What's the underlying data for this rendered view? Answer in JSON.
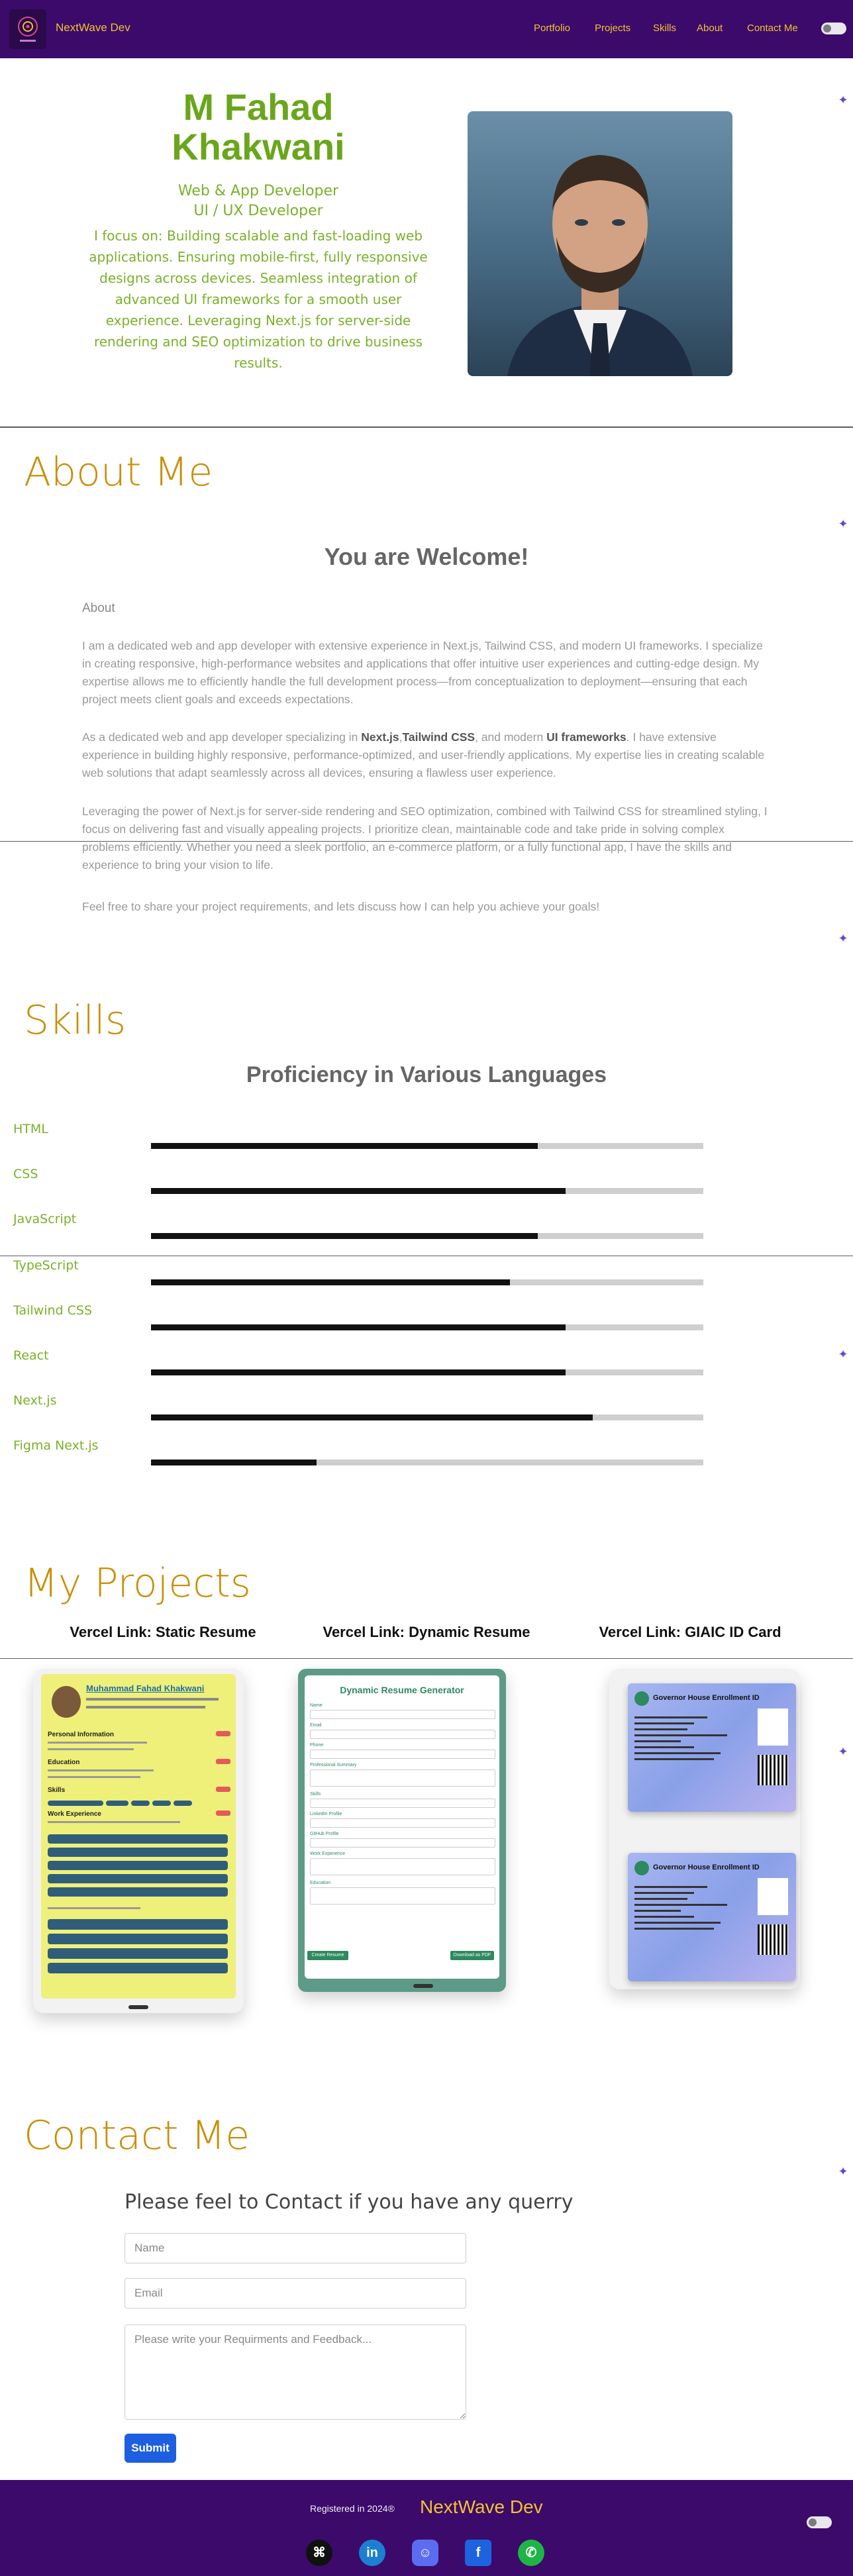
{
  "header": {
    "brand": "NextWave Dev",
    "nav": [
      "Portfolio",
      "Projects",
      "Skills",
      "About",
      "Contact Me"
    ]
  },
  "hero": {
    "name": "M Fahad Khakwani",
    "role1": "Web & App Developer",
    "role2": "UI / UX Developer",
    "description": "I focus on: Building scalable and fast-loading web applications. Ensuring mobile-first, fully responsive designs across devices. Seamless integration of advanced UI frameworks for a smooth user experience. Leveraging Next.js for server-side rendering and SEO optimization to drive business results."
  },
  "about": {
    "title": "About Me",
    "subtitle": "You are Welcome!",
    "label": "About",
    "p1": "I am a dedicated web and app developer with extensive experience in Next.js, Tailwind CSS, and modern UI frameworks. I specialize in creating responsive, high-performance websites and applications that offer intuitive user experiences and cutting-edge design. My expertise allows me to efficiently handle the full development process—from conceptualization to deployment—ensuring that each project meets client goals and exceeds expectations.",
    "p2_a": "As a dedicated web and app developer specializing in ",
    "p2_b": "Next.js",
    "p2_c": ",",
    "p2_d": "Tailwind CSS",
    "p2_e": ", and modern ",
    "p2_f": "UI frameworks",
    "p2_g": ". I have extensive experience in building highly responsive, performance-optimized, and user-friendly applications. My expertise lies in creating scalable web solutions that adapt seamlessly across all devices, ensuring a flawless user experience.",
    "p3": "Leveraging the power of Next.js for server-side rendering and SEO optimization, combined with Tailwind CSS for streamlined styling, I focus on delivering fast and visually appealing projects. I prioritize clean, maintainable code and take pride in solving complex problems efficiently. Whether you need a sleek portfolio, an e-commerce platform, or a fully functional app, I have the skills and experience to bring your vision to life.",
    "p4": "Feel free to share your project requirements, and lets discuss how I can help you achieve your goals!"
  },
  "skills": {
    "title": "Skills",
    "subtitle": "Proficiency in Various Languages",
    "items": [
      {
        "name": "HTML",
        "level": 0.7
      },
      {
        "name": "CSS",
        "level": 0.75
      },
      {
        "name": "JavaScript",
        "level": 0.7
      },
      {
        "name": "TypeScript",
        "level": 0.65
      },
      {
        "name": "Tailwind CSS",
        "level": 0.75
      },
      {
        "name": "React",
        "level": 0.75
      },
      {
        "name": "Next.js",
        "level": 0.8
      },
      {
        "name": "Figma Next.js",
        "level": 0.3
      }
    ]
  },
  "projects": {
    "title": "My Projects",
    "items": [
      {
        "title": "Vercel Link: Static Resume"
      },
      {
        "title": "Vercel Link: Dynamic Resume"
      },
      {
        "title": "Vercel Link: GIAIC ID Card"
      }
    ],
    "static_resume": {
      "name": "Muhammad Fahad Khakwani",
      "sections": [
        "Personal Information",
        "Education",
        "Skills",
        "Work Experience"
      ]
    },
    "dynamic_resume": {
      "heading": "Dynamic Resume Generator",
      "fields": [
        "Name",
        "Email",
        "Phone",
        "Professional Summary",
        "Skills",
        "LinkedIn Profile",
        "GitHub Profile",
        "Work Experience",
        "Education"
      ],
      "btn_left": "Create Resume",
      "btn_right": "Download as PDF"
    },
    "id_card": {
      "heading": "Governor House Enrollment ID"
    }
  },
  "contact": {
    "title": "Contact Me",
    "subtitle": "Please feel to Contact if you have any querry",
    "name_placeholder": "Name",
    "email_placeholder": "Email",
    "feedback_placeholder": "Please write your Requirments and Feedback...",
    "submit": "Submit"
  },
  "footer": {
    "registered": "Registered in 2024®",
    "brand": "NextWave Dev",
    "social": [
      "github-icon",
      "linkedin-icon",
      "discord-icon",
      "facebook-icon",
      "whatsapp-icon"
    ]
  },
  "colors": {
    "header_bg": "#3b0a6b",
    "brand": "#f2c230",
    "hero_green": "#6aa61c",
    "section_gold": "#c98f0a",
    "submit_blue": "#1d5fe0"
  }
}
